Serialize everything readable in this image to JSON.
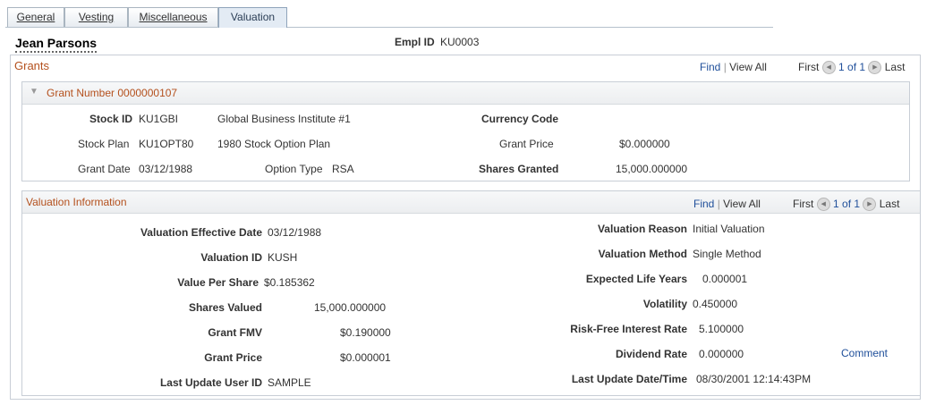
{
  "tabs": [
    {
      "label": "General"
    },
    {
      "label": "Vesting"
    },
    {
      "label": "Miscellaneous"
    },
    {
      "label": "Valuation"
    }
  ],
  "employee": {
    "name": "Jean Parsons",
    "empl_id_label": "Empl ID",
    "empl_id": "KU0003"
  },
  "grants": {
    "title": "Grants",
    "nav": {
      "find": "Find",
      "view_all": "View All",
      "first": "First",
      "range": "1 of 1",
      "last": "Last"
    },
    "grant_number_label": "Grant Number 0000000107",
    "fields": {
      "stock_id_label": "Stock ID",
      "stock_id": "KU1GBI",
      "stock_desc": "Global Business Institute #1",
      "currency_code_label": "Currency Code",
      "currency_code": "",
      "stock_plan_label": "Stock Plan",
      "stock_plan": "KU1OPT80",
      "stock_plan_desc": "1980 Stock Option Plan",
      "grant_price_label": "Grant Price",
      "grant_price": "$0.000000",
      "grant_date_label": "Grant Date",
      "grant_date": "03/12/1988",
      "option_type_label": "Option Type",
      "option_type": "RSA",
      "shares_granted_label": "Shares Granted",
      "shares_granted": "15,000.000000"
    }
  },
  "valuation": {
    "title": "Valuation Information",
    "nav": {
      "find": "Find",
      "view_all": "View All",
      "first": "First",
      "range": "1 of 1",
      "last": "Last"
    },
    "left": {
      "eff_date_label": "Valuation Effective Date",
      "eff_date": "03/12/1988",
      "val_id_label": "Valuation ID",
      "val_id": "KUSH",
      "vps_label": "Value Per Share",
      "vps": "$0.185362",
      "shares_valued_label": "Shares Valued",
      "shares_valued": "15,000.000000",
      "grant_fmv_label": "Grant FMV",
      "grant_fmv": "$0.190000",
      "grant_price_label": "Grant Price",
      "grant_price": "$0.000001",
      "last_user_label": "Last Update User ID",
      "last_user": "SAMPLE"
    },
    "right": {
      "reason_label": "Valuation Reason",
      "reason": "Initial Valuation",
      "method_label": "Valuation Method",
      "method": "Single Method",
      "life_label": "Expected Life Years",
      "life": "0.000001",
      "volatility_label": "Volatility",
      "volatility": "0.450000",
      "rfr_label": "Risk-Free Interest Rate",
      "rfr": "5.100000",
      "dividend_label": "Dividend Rate",
      "dividend": "0.000000",
      "comment_link": "Comment",
      "last_dt_label": "Last Update Date/Time",
      "last_dt": "08/30/2001 12:14:43PM"
    }
  }
}
